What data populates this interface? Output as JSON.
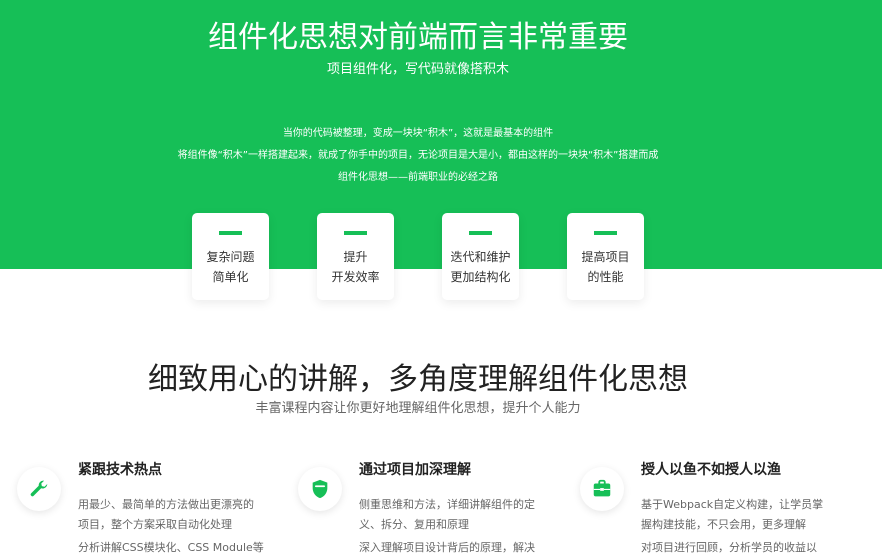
{
  "hero": {
    "title": "组件化思想对前端而言非常重要",
    "subtitle": "项目组件化，写代码就像搭积木",
    "description": [
      "当你的代码被整理，变成一块块“积木”，这就是最基本的组件",
      "将组件像“积木”一样搭建起来，就成了你手中的项目，无论项目是大是小，都由这样的一块块“积木”搭建而成",
      "组件化思想——前端职业的必经之路"
    ],
    "cards": [
      {
        "line1": "复杂问题",
        "line2": "简单化"
      },
      {
        "line1": "提升",
        "line2": "开发效率"
      },
      {
        "line1": "迭代和维护",
        "line2": "更加结构化"
      },
      {
        "line1": "提高项目",
        "line2": "的性能"
      }
    ]
  },
  "section": {
    "title": "细致用心的讲解，多角度理解组件化思想",
    "subtitle": "丰富课程内容让你更好地理解组件化思想，提升个人能力"
  },
  "features": [
    {
      "icon": "wrench-icon",
      "title": "紧跟技术热点",
      "desc": [
        "用最少、最简单的方法做出更漂亮的",
        "项目，整个方案采取自动化处理"
      ],
      "extra": "分析讲解CSS模块化、CSS Module等"
    },
    {
      "icon": "shield-icon",
      "title": "通过项目加深理解",
      "desc": [
        "侧重思维和方法，详细讲解组件的定",
        "义、拆分、复用和原理"
      ],
      "extra": "深入理解项目设计背后的原理，解决"
    },
    {
      "icon": "toolbox-icon",
      "title": "授人以鱼不如授人以渔",
      "desc": [
        "基于Webpack自定义构建，让学员掌",
        "握构建技能，不只会用，更多理解"
      ],
      "extra": "对项目进行回顾，分析学员的收益以"
    }
  ],
  "colors": {
    "brand_green": "#16bf57",
    "title_dark": "#222222",
    "text_gray": "#666666"
  }
}
